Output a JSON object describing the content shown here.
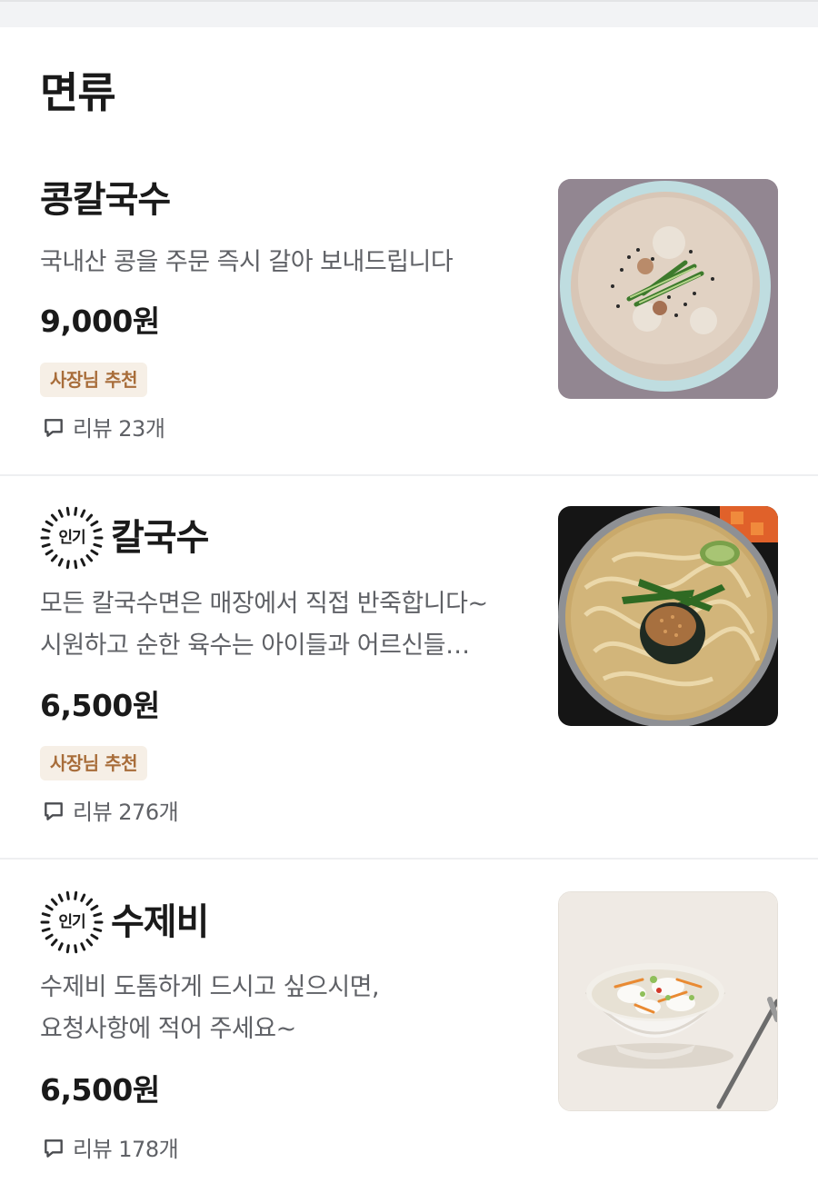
{
  "section": {
    "title": "면류"
  },
  "items": [
    {
      "name": "콩칼국수",
      "popular_label": "",
      "description_lines": [
        "국내산 콩을 주문 즉시 갈아 보내드립니다"
      ],
      "price": "9,000원",
      "badge": "사장님 추천",
      "review_label": "리뷰 23개",
      "photo_icon": "kongguksu-photo"
    },
    {
      "name": "칼국수",
      "popular_label": "인기",
      "description_lines": [
        "모든 칼국수면은 매장에서 직접 반죽합니다~",
        "시원하고 순한 육수는 아이들과 어르신들…"
      ],
      "price": "6,500원",
      "badge": "사장님 추천",
      "review_label": "리뷰 276개",
      "photo_icon": "kalguksu-photo"
    },
    {
      "name": "수제비",
      "popular_label": "인기",
      "description_lines": [
        "수제비 도톰하게 드시고 싶으시면,",
        "요청사항에 적어 주세요~"
      ],
      "price": "6,500원",
      "badge": "",
      "review_label": "리뷰 178개",
      "photo_icon": "sujebi-photo"
    }
  ],
  "colors": {
    "badge_bg": "#f6efe6",
    "badge_text": "#a86d3a",
    "secondary_text": "#5f6166",
    "primary_text": "#1a1a1a",
    "divider": "#eeeff1"
  }
}
